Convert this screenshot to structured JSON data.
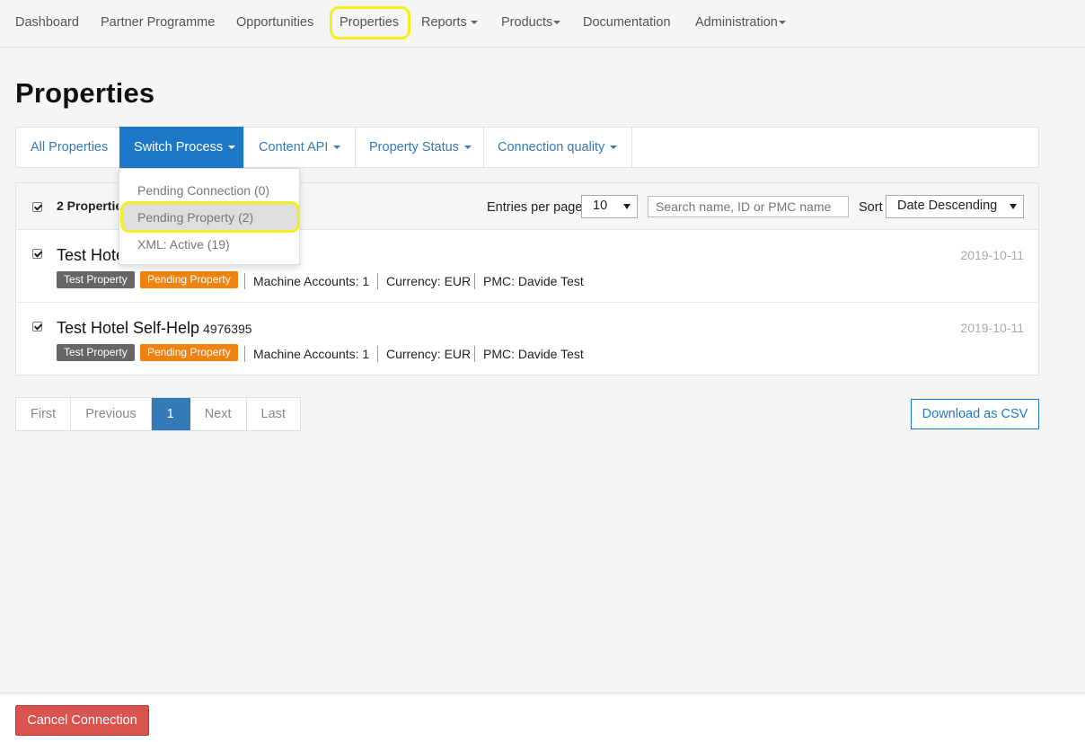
{
  "nav": {
    "items": [
      {
        "label": "Dashboard"
      },
      {
        "label": "Partner Programme"
      },
      {
        "label": "Opportunities"
      },
      {
        "label": "Properties"
      },
      {
        "label": "Reports"
      },
      {
        "label": "Products"
      },
      {
        "label": "Documentation"
      },
      {
        "label": "Administration"
      }
    ]
  },
  "page": {
    "title": "Properties"
  },
  "tabs": [
    {
      "label": "All Properties"
    },
    {
      "label": "Switch Process"
    },
    {
      "label": "Content API"
    },
    {
      "label": "Property Status"
    },
    {
      "label": "Connection quality"
    }
  ],
  "dropdown": {
    "items": [
      {
        "label": "Pending Connection (0)"
      },
      {
        "label": "Pending Property (2)"
      },
      {
        "label": "XML: Active (19)"
      }
    ]
  },
  "list": {
    "count_label": "2 Propertie",
    "entries_label": "Entries per page",
    "entries_value": "10",
    "search_placeholder": "Search name, ID or PMC name",
    "sort_label": "Sort",
    "sort_value": "Date Descending"
  },
  "rows": [
    {
      "title": "Test Hote",
      "id": "",
      "date": "2019-10-11",
      "badge1": "Test Property",
      "badge2": "Pending Property",
      "machine": "Machine Accounts: 1",
      "currency": "Currency: EUR",
      "pmc": "PMC: Davide Test"
    },
    {
      "title": "Test Hotel Self-Help",
      "id": "4976395",
      "date": "2019-10-11",
      "badge1": "Test Property",
      "badge2": "Pending Property",
      "machine": "Machine Accounts: 1",
      "currency": "Currency: EUR",
      "pmc": "PMC: Davide Test"
    }
  ],
  "pagination": {
    "first": "First",
    "previous": "Previous",
    "current": "1",
    "next": "Next",
    "last": "Last"
  },
  "actions": {
    "download_csv": "Download as CSV",
    "cancel_connection": "Cancel Connection"
  },
  "colors": {
    "primary": "#1d79c8",
    "highlight": "#f4ef1c",
    "pending_badge": "#f0830f",
    "danger": "#d9534f"
  }
}
